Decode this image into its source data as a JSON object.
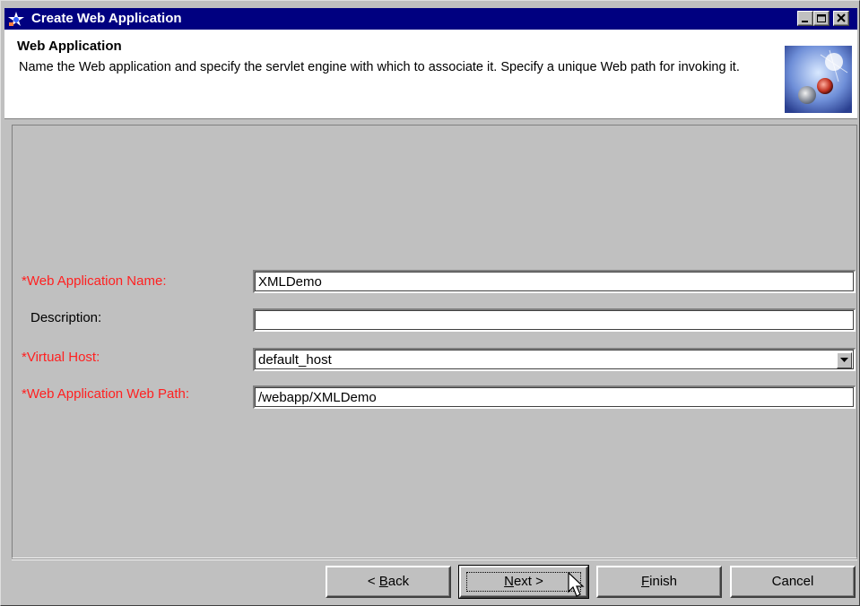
{
  "window": {
    "title": "Create Web Application"
  },
  "header": {
    "title": "Web Application",
    "description": "Name the Web application and specify the servlet engine with which to associate it. Specify a unique Web path for invoking it."
  },
  "form": {
    "required_marker": "*",
    "fields": {
      "name": {
        "label": "Web Application Name:",
        "value": "XMLDemo",
        "required": true
      },
      "description": {
        "label": "Description:",
        "value": "",
        "required": false
      },
      "virtual_host": {
        "label": "Virtual Host:",
        "value": "default_host",
        "required": true
      },
      "web_path": {
        "label": "Web Application Web Path:",
        "value": "/webapp/XMLDemo",
        "required": true
      }
    }
  },
  "buttons": {
    "back": {
      "prefix": "< ",
      "mnemonic": "B",
      "rest": "ack"
    },
    "next": {
      "mnemonic": "N",
      "rest": "ext >"
    },
    "finish": {
      "mnemonic": "F",
      "rest": "inish"
    },
    "cancel": {
      "label": "Cancel"
    }
  },
  "colors": {
    "title_bar": "#000080",
    "required_label": "#ff2020",
    "panel": "#c0c0c0"
  },
  "icons": {
    "app": "web-app-wizard-icon",
    "header_graphic": "globe-banner-icon",
    "combo": "chevron-down-icon",
    "cursor": "mouse-pointer-icon"
  }
}
